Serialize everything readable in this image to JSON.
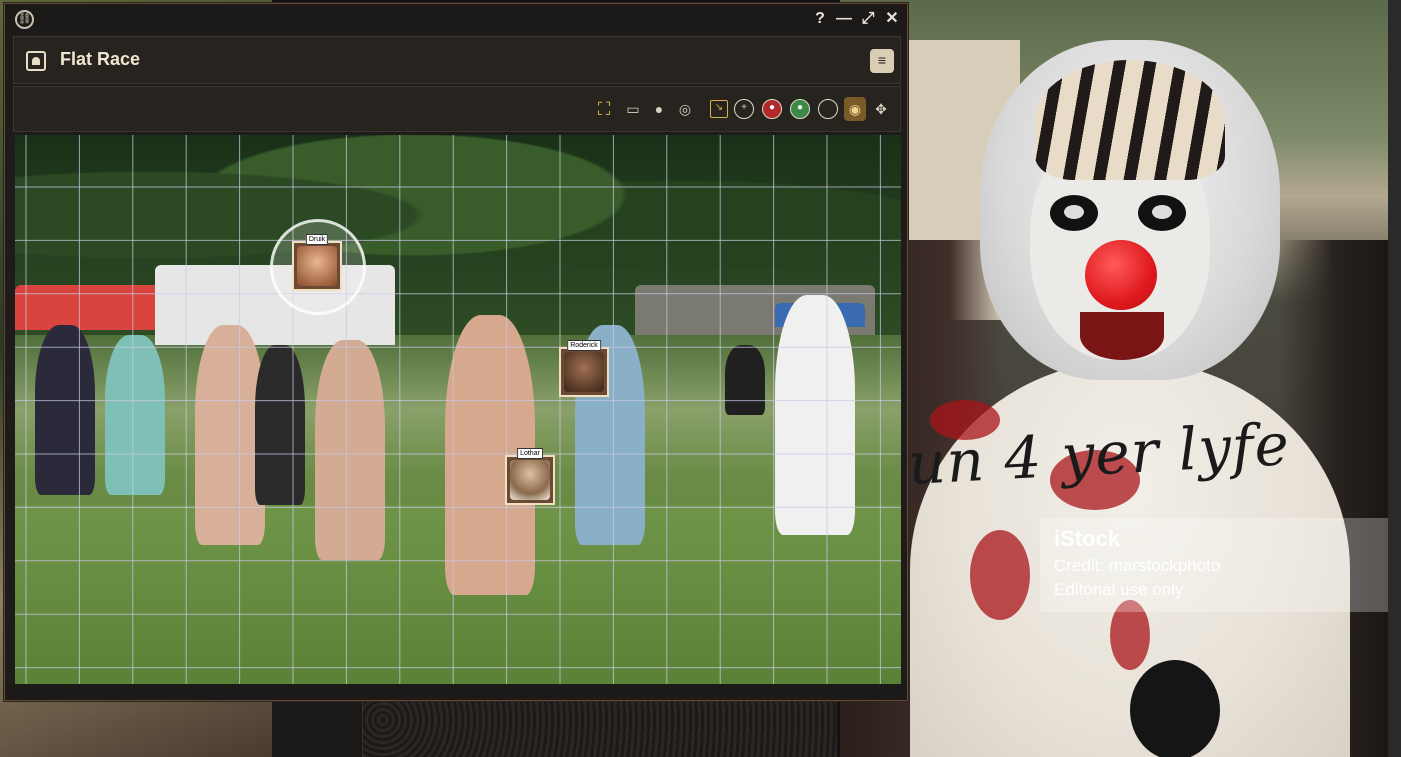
{
  "window": {
    "header_title": "Flat Race",
    "controls": {
      "help": "?",
      "minimize": "—",
      "maximize": "⤢",
      "close": "✕"
    },
    "menu_glyph": "≡"
  },
  "toolbar": {
    "icons": [
      "fullscreen-icon",
      "camera-icon",
      "person-icon",
      "target-icon",
      "note-icon",
      "crosshair-icon",
      "red-token-icon",
      "green-token-icon",
      "circle-icon",
      "eye-icon",
      "move-icon"
    ]
  },
  "tokens": [
    {
      "name": "Druik",
      "color": "#b06a3a"
    },
    {
      "name": "Roderick",
      "color": "#5a3a2a"
    },
    {
      "name": "Lothar",
      "color": "#8a6a4a"
    }
  ],
  "background_photo": {
    "costume_text": "un 4 yer lyfe",
    "watermark": {
      "brand": "iStock",
      "credit": "Credit: marstockphoto",
      "note": "Editorial use only"
    }
  },
  "colors": {
    "accent": "#d8b04a",
    "window_bg": "#1e1c1a",
    "header_text": "#f1e7d0"
  }
}
